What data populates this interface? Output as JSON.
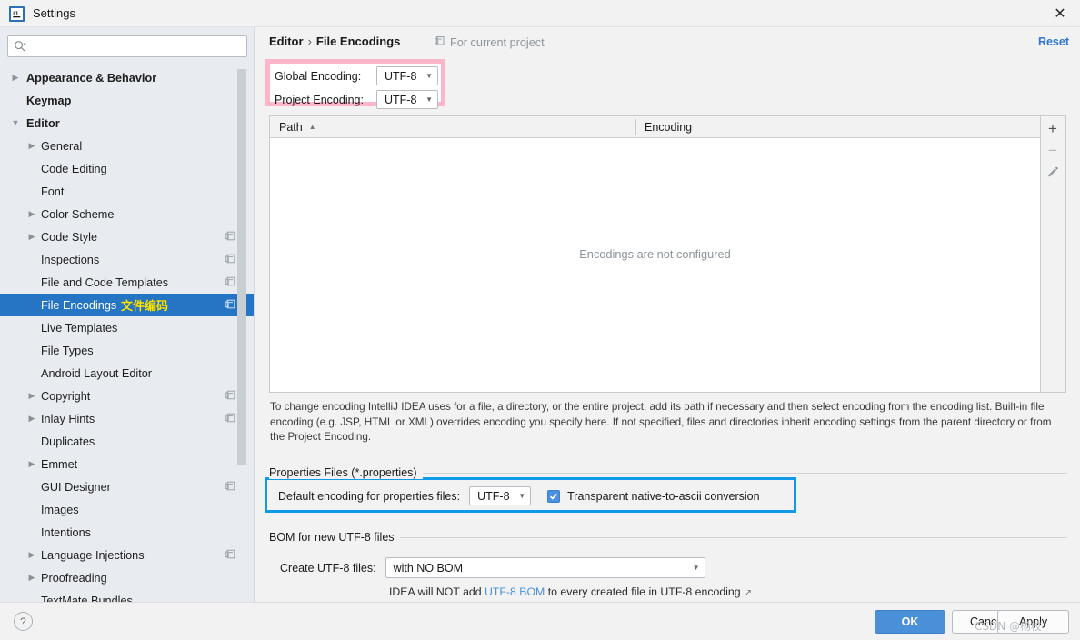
{
  "window": {
    "title": "Settings",
    "app_icon": "intellij-idea-icon",
    "close_label": "✕"
  },
  "sidebar": {
    "search": {
      "value": "",
      "placeholder": "",
      "icon": "search-icon"
    },
    "items": [
      {
        "label": "Appearance & Behavior",
        "level": 0,
        "arrow": "▶",
        "bold": true,
        "badge": false,
        "selected": false
      },
      {
        "label": "Keymap",
        "level": 0,
        "arrow": "",
        "bold": true,
        "badge": false,
        "selected": false
      },
      {
        "label": "Editor",
        "level": 0,
        "arrow": "▼",
        "bold": true,
        "badge": false,
        "selected": false
      },
      {
        "label": "General",
        "level": 1,
        "arrow": "▶",
        "bold": false,
        "badge": false,
        "selected": false
      },
      {
        "label": "Code Editing",
        "level": 1,
        "arrow": "",
        "bold": false,
        "badge": false,
        "selected": false
      },
      {
        "label": "Font",
        "level": 1,
        "arrow": "",
        "bold": false,
        "badge": false,
        "selected": false
      },
      {
        "label": "Color Scheme",
        "level": 1,
        "arrow": "▶",
        "bold": false,
        "badge": false,
        "selected": false
      },
      {
        "label": "Code Style",
        "level": 1,
        "arrow": "▶",
        "bold": false,
        "badge": true,
        "selected": false
      },
      {
        "label": "Inspections",
        "level": 1,
        "arrow": "",
        "bold": false,
        "badge": true,
        "selected": false
      },
      {
        "label": "File and Code Templates",
        "level": 1,
        "arrow": "",
        "bold": false,
        "badge": true,
        "selected": false
      },
      {
        "label": "File Encodings",
        "level": 1,
        "arrow": "",
        "bold": false,
        "badge": true,
        "selected": true,
        "note": "文件编码"
      },
      {
        "label": "Live Templates",
        "level": 1,
        "arrow": "",
        "bold": false,
        "badge": false,
        "selected": false
      },
      {
        "label": "File Types",
        "level": 1,
        "arrow": "",
        "bold": false,
        "badge": false,
        "selected": false
      },
      {
        "label": "Android Layout Editor",
        "level": 1,
        "arrow": "",
        "bold": false,
        "badge": false,
        "selected": false
      },
      {
        "label": "Copyright",
        "level": 1,
        "arrow": "▶",
        "bold": false,
        "badge": true,
        "selected": false
      },
      {
        "label": "Inlay Hints",
        "level": 1,
        "arrow": "▶",
        "bold": false,
        "badge": true,
        "selected": false
      },
      {
        "label": "Duplicates",
        "level": 1,
        "arrow": "",
        "bold": false,
        "badge": false,
        "selected": false
      },
      {
        "label": "Emmet",
        "level": 1,
        "arrow": "▶",
        "bold": false,
        "badge": false,
        "selected": false
      },
      {
        "label": "GUI Designer",
        "level": 1,
        "arrow": "",
        "bold": false,
        "badge": true,
        "selected": false
      },
      {
        "label": "Images",
        "level": 1,
        "arrow": "",
        "bold": false,
        "badge": false,
        "selected": false
      },
      {
        "label": "Intentions",
        "level": 1,
        "arrow": "",
        "bold": false,
        "badge": false,
        "selected": false
      },
      {
        "label": "Language Injections",
        "level": 1,
        "arrow": "▶",
        "bold": false,
        "badge": true,
        "selected": false
      },
      {
        "label": "Proofreading",
        "level": 1,
        "arrow": "▶",
        "bold": false,
        "badge": false,
        "selected": false
      },
      {
        "label": "TextMate Bundles",
        "level": 1,
        "arrow": "",
        "bold": false,
        "badge": false,
        "selected": false
      }
    ]
  },
  "header": {
    "breadcrumb_parent": "Editor",
    "breadcrumb_sep": "›",
    "breadcrumb_current": "File Encodings",
    "for_current_project": "For current project",
    "for_current_project_icon": "project-scope-icon",
    "reset_label": "Reset"
  },
  "encoding": {
    "global_label": "Global Encoding:",
    "global_value": "UTF-8",
    "project_label": "Project Encoding:",
    "project_value": "UTF-8",
    "caret": "▼",
    "highlight_color": "#fdb6c9"
  },
  "table": {
    "col_path": "Path",
    "col_encoding": "Encoding",
    "sort_arrow": "▲",
    "empty_message": "Encodings are not configured",
    "rows": [],
    "tools": {
      "add": "+",
      "remove": "−",
      "edit_icon": "pencil-icon"
    }
  },
  "description": "To change encoding IntelliJ IDEA uses for a file, a directory, or the entire project, add its path if necessary and then select encoding from the encoding list. Built-in file encoding (e.g. JSP, HTML or XML) overrides encoding you specify here. If not specified, files and directories inherit encoding settings from the parent directory or from the Project Encoding.",
  "properties_group": {
    "title": "Properties Files (*.properties)",
    "default_encoding_label": "Default encoding for properties files:",
    "default_encoding_value": "UTF-8",
    "caret": "▼",
    "transparent_label": "Transparent native-to-ascii conversion",
    "transparent_checked": true,
    "highlight_color": "#0f9ae8"
  },
  "bom_group": {
    "title": "BOM for new UTF-8 files",
    "create_label": "Create UTF-8 files:",
    "create_value": "with NO BOM",
    "caret": "▼",
    "note_prefix": "IDEA will NOT add ",
    "note_link": "UTF-8 BOM",
    "note_suffix": " to every created file in UTF-8 encoding",
    "external_arrow": "↗"
  },
  "footer": {
    "help_label": "?",
    "ok_label": "OK",
    "cancel_label": "Cancel",
    "apply_label": "Apply",
    "watermark": "CSDN @杨校"
  }
}
